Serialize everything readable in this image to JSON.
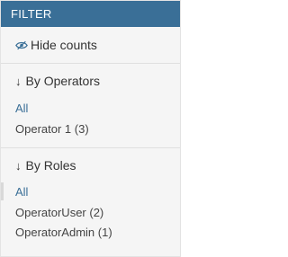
{
  "header": {
    "title": "FILTER"
  },
  "toggle": {
    "label": "Hide counts",
    "icon": "eye-slash-icon"
  },
  "operators": {
    "title": "By Operators",
    "all_label": "All",
    "items": [
      {
        "label": "Operator 1 (3)"
      }
    ]
  },
  "roles": {
    "title": "By Roles",
    "all_label": "All",
    "items": [
      {
        "label": "OperatorUser (2)"
      },
      {
        "label": "OperatorAdmin (1)"
      }
    ]
  },
  "colors": {
    "header_bg": "#3a6f97",
    "link": "#3a6f97",
    "panel_bg": "#f5f5f5"
  }
}
